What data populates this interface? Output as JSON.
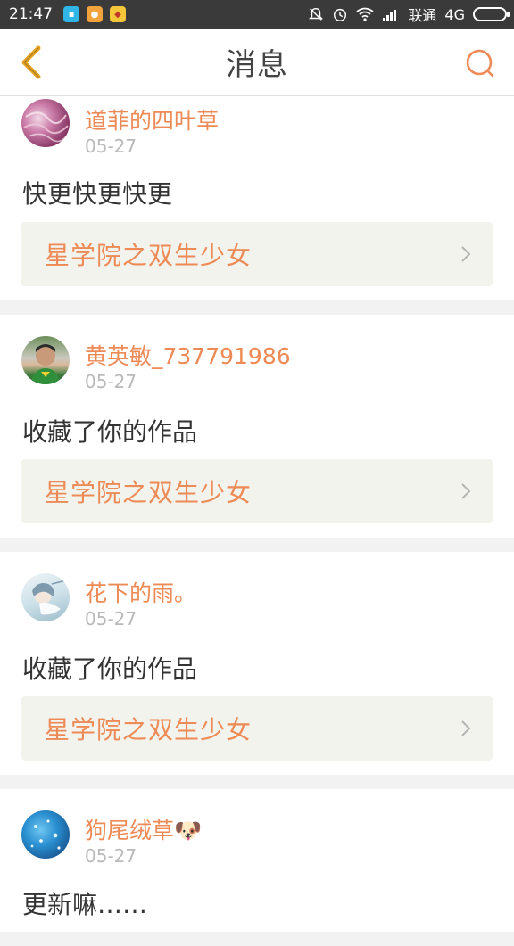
{
  "status_bar": {
    "time": "21:47",
    "carrier": "联通",
    "network": "4G",
    "app_icons": [
      "message-app-icon",
      "chat-app-icon",
      "game-app-icon"
    ]
  },
  "header": {
    "title": "消息",
    "back_icon": "chevron-left-icon",
    "search_icon": "search-icon",
    "accent_color": "#ee8a55"
  },
  "messages": [
    {
      "username": "道菲的四叶草",
      "date": "05-27",
      "text": "快更快更快更",
      "work": "星学院之双生少女"
    },
    {
      "username": "黄英敏_737791986",
      "date": "05-27",
      "text": "收藏了你的作品",
      "work": "星学院之双生少女"
    },
    {
      "username": "花下的雨。",
      "date": "05-27",
      "text": "收藏了你的作品",
      "work": "星学院之双生少女"
    },
    {
      "username": "狗尾绒草",
      "username_emoji": "🐶",
      "date": "05-27",
      "text": "更新嘛……",
      "work": ""
    }
  ]
}
